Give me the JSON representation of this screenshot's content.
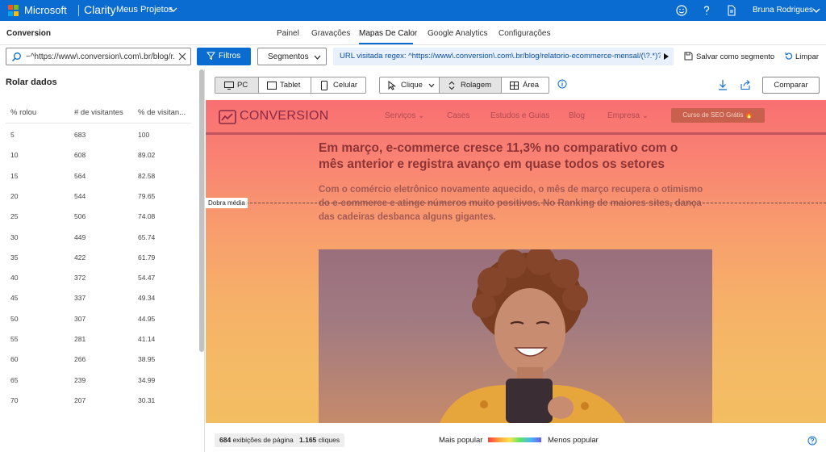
{
  "topbar": {
    "brand": "Microsoft",
    "product": "Clarity",
    "projects": "Meus Projetos",
    "user": "Bruna Rodrigues",
    "accent": "#0a6bd0",
    "icons": [
      "smiley-icon",
      "help-icon",
      "document-icon"
    ]
  },
  "nav": {
    "project_name": "Conversion",
    "tabs": [
      "Painel",
      "Gravações",
      "Mapas De Calor",
      "Google Analytics",
      "Configurações"
    ],
    "active_tab": "Mapas De Calor"
  },
  "filters": {
    "search_value": "~^https://www\\.conversion\\.com\\.br/blog/r...",
    "filter_label": "Filtros",
    "segments_label": "Segmentos",
    "url_text": "URL visitada regex: ^https://www\\.conversion\\.com\\.br/blog/relatorio-ecommerce-mensal/(\\?.*)?$",
    "save_segment": "Salvar como segmento",
    "clear": "Limpar"
  },
  "scroll_panel": {
    "title": "Rolar dados",
    "headers": [
      "% rolou",
      "# de visitantes",
      "% de visitan..."
    ],
    "rows": [
      [
        "5",
        "683",
        "100"
      ],
      [
        "10",
        "608",
        "89.02"
      ],
      [
        "15",
        "564",
        "82.58"
      ],
      [
        "20",
        "544",
        "79.65"
      ],
      [
        "25",
        "506",
        "74.08"
      ],
      [
        "30",
        "449",
        "65.74"
      ],
      [
        "35",
        "422",
        "61.79"
      ],
      [
        "40",
        "372",
        "54.47"
      ],
      [
        "45",
        "337",
        "49.34"
      ],
      [
        "50",
        "307",
        "44.95"
      ],
      [
        "55",
        "281",
        "41.14"
      ],
      [
        "60",
        "266",
        "38.95"
      ],
      [
        "65",
        "239",
        "34.99"
      ],
      [
        "70",
        "207",
        "30.31"
      ]
    ]
  },
  "toolbar": {
    "devices": [
      "PC",
      "Tablet",
      "Celular"
    ],
    "selected_device": "PC",
    "modes": [
      "Clique",
      "Rolagem",
      "Área"
    ],
    "selected_mode": "Rolagem",
    "compare": "Comparar"
  },
  "page": {
    "brand": "CONVERSION",
    "nav": [
      "Serviços",
      "Cases",
      "Estudos e Guias",
      "Blog",
      "Empresa"
    ],
    "cta": "Curso de SEO Grátis 🔥",
    "title": "Em março, e-commerce cresce 11,3% no comparativo com o mês anterior e registra avanço em quase todos os setores",
    "subtitle": "Com o comércio eletrônico novamente aquecido, o mês de março recupera o otimismo do e-commerce e atinge números muito positivos. No Ranking de maiores sites, dança das cadeiras desbanca alguns gigantes.",
    "fold_label": "Dobra média"
  },
  "footer": {
    "pageviews": "684",
    "pageviews_label": "exibições de página",
    "clicks": "1.165",
    "clicks_label": "cliques",
    "legend_left": "Mais popular",
    "legend_right": "Menos popular"
  }
}
